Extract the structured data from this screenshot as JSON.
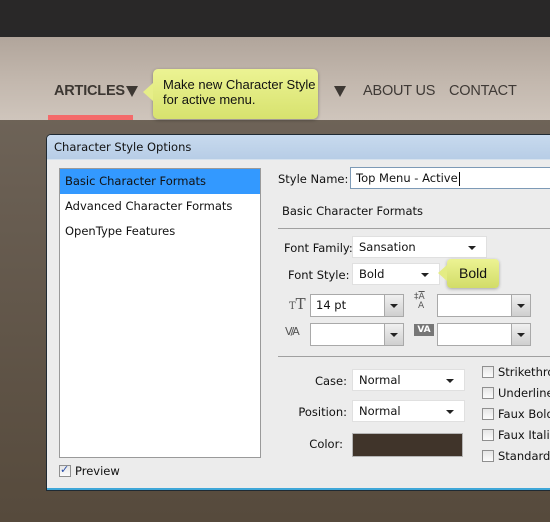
{
  "website": {
    "nav": {
      "items": [
        {
          "label": "ARTICLES",
          "active": true,
          "has_dropdown": true
        },
        {
          "label": "ABOUT US",
          "active": false,
          "has_dropdown": false
        },
        {
          "label": "CONTACT",
          "active": false,
          "has_dropdown": false
        }
      ],
      "active_color": "#f46a6a"
    },
    "callout_main": "Make new Character Style for active menu.",
    "callout_main_lines": [
      "Make new Character Style",
      "for active menu."
    ],
    "callout_font_style": "Bold"
  },
  "dialog": {
    "title": "Character Style Options",
    "sections": [
      {
        "label": "Basic Character Formats",
        "selected": true
      },
      {
        "label": "Advanced Character Formats",
        "selected": false
      },
      {
        "label": "OpenType Features",
        "selected": false
      }
    ],
    "preview": {
      "label": "Preview",
      "checked": true
    },
    "style_name": {
      "label": "Style Name:",
      "value": "Top Menu - Active"
    },
    "section_heading": "Basic Character Formats",
    "font_family": {
      "label": "Font Family:",
      "value": "Sansation"
    },
    "font_style": {
      "label": "Font Style:",
      "value": "Bold"
    },
    "size": {
      "icon": "font-size-icon",
      "value": "14 pt"
    },
    "leading": {
      "icon": "leading-icon",
      "value": ""
    },
    "kerning": {
      "icon": "kerning-icon",
      "value": ""
    },
    "tracking": {
      "icon": "tracking-icon",
      "value": ""
    },
    "case": {
      "label": "Case:",
      "value": "Normal"
    },
    "position": {
      "label": "Position:",
      "value": "Normal"
    },
    "color": {
      "label": "Color:",
      "value": "#40342a"
    },
    "checkboxes": [
      {
        "label": "Strikethrough",
        "visible_label": "Strikethro",
        "checked": false
      },
      {
        "label": "Underline",
        "visible_label": "Underline",
        "checked": false
      },
      {
        "label": "Faux Bold",
        "visible_label": "Faux Bold",
        "checked": false
      },
      {
        "label": "Faux Italic",
        "visible_label": "Faux Italic",
        "checked": false
      },
      {
        "label": "Standard",
        "visible_label": "Standard",
        "checked": false
      }
    ]
  }
}
